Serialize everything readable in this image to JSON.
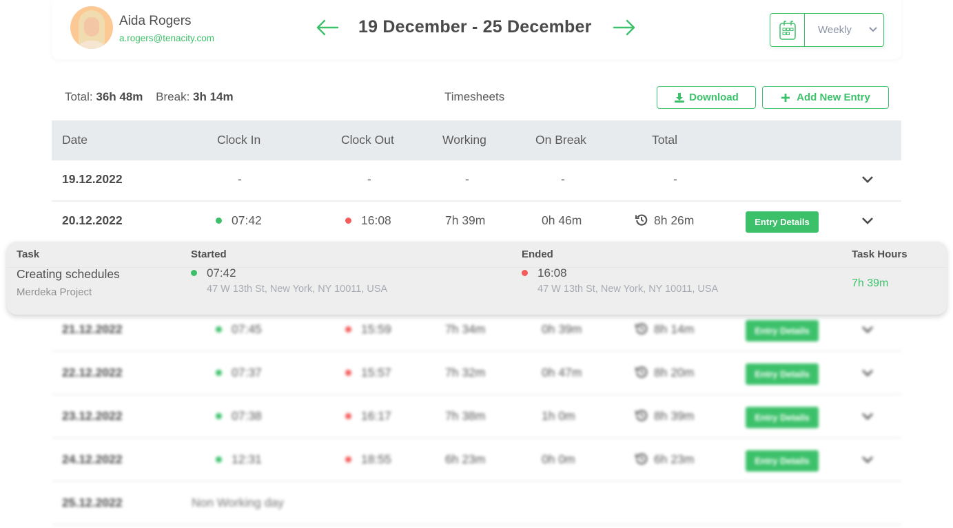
{
  "user": {
    "name": "Aida Rogers",
    "email": "a.rogers@tenacity.com"
  },
  "week": {
    "title": "19 December - 25 December",
    "prev_icon": "arrow-left-icon",
    "next_icon": "arrow-right-icon"
  },
  "period_select": {
    "icon": "calendar-icon",
    "value": "Weekly"
  },
  "summary": {
    "total_label": "Total:",
    "total_value": "36h 48m",
    "break_label": "Break:",
    "break_value": "3h 14m",
    "section_title": "Timesheets",
    "download_label": "Download",
    "add_label": "Add New Entry"
  },
  "table": {
    "headers": [
      "Date",
      "Clock In",
      "Clock Out",
      "Working",
      "On Break",
      "Total"
    ],
    "entry_button_label": "Entry Details",
    "rows": [
      {
        "date": "19.12.2022",
        "clock_in": "-",
        "clock_out": "-",
        "working": "-",
        "on_break": "-",
        "total": "-"
      },
      {
        "date": "20.12.2022",
        "clock_in": "07:42",
        "clock_out": "16:08",
        "working": "7h 39m",
        "on_break": "0h 46m",
        "total": "8h 26m"
      },
      {
        "date": "21.12.2022",
        "clock_in": "07:45",
        "clock_out": "15:59",
        "working": "7h 34m",
        "on_break": "0h 39m",
        "total": "8h 14m"
      },
      {
        "date": "22.12.2022",
        "clock_in": "07:37",
        "clock_out": "15:57",
        "working": "7h 32m",
        "on_break": "0h 47m",
        "total": "8h 20m"
      },
      {
        "date": "23.12.2022",
        "clock_in": "07:38",
        "clock_out": "16:17",
        "working": "7h 38m",
        "on_break": "1h 0m",
        "total": "8h 39m"
      },
      {
        "date": "24.12.2022",
        "clock_in": "12:31",
        "clock_out": "18:55",
        "working": "6h 23m",
        "on_break": "0h 0m",
        "total": "6h 23m"
      },
      {
        "date": "25.12.2022",
        "note": "Non Working day"
      }
    ]
  },
  "entry_detail": {
    "headers": {
      "task": "Task",
      "started": "Started",
      "ended": "Ended",
      "task_hours": "Task Hours"
    },
    "task": "Creating schedules",
    "project": "Merdeka Project",
    "started_time": "07:42",
    "started_address": "47 W 13th St, New York, NY 10011, USA",
    "ended_time": "16:08",
    "ended_address": "47 W 13th St, New York, NY 10011, USA",
    "task_hours": "7h 39m"
  },
  "colors": {
    "accent": "#3cc16a",
    "clock_in_dot": "#3cc16a",
    "clock_out_dot": "#f45b5b",
    "header_bg": "#e8ebee"
  }
}
